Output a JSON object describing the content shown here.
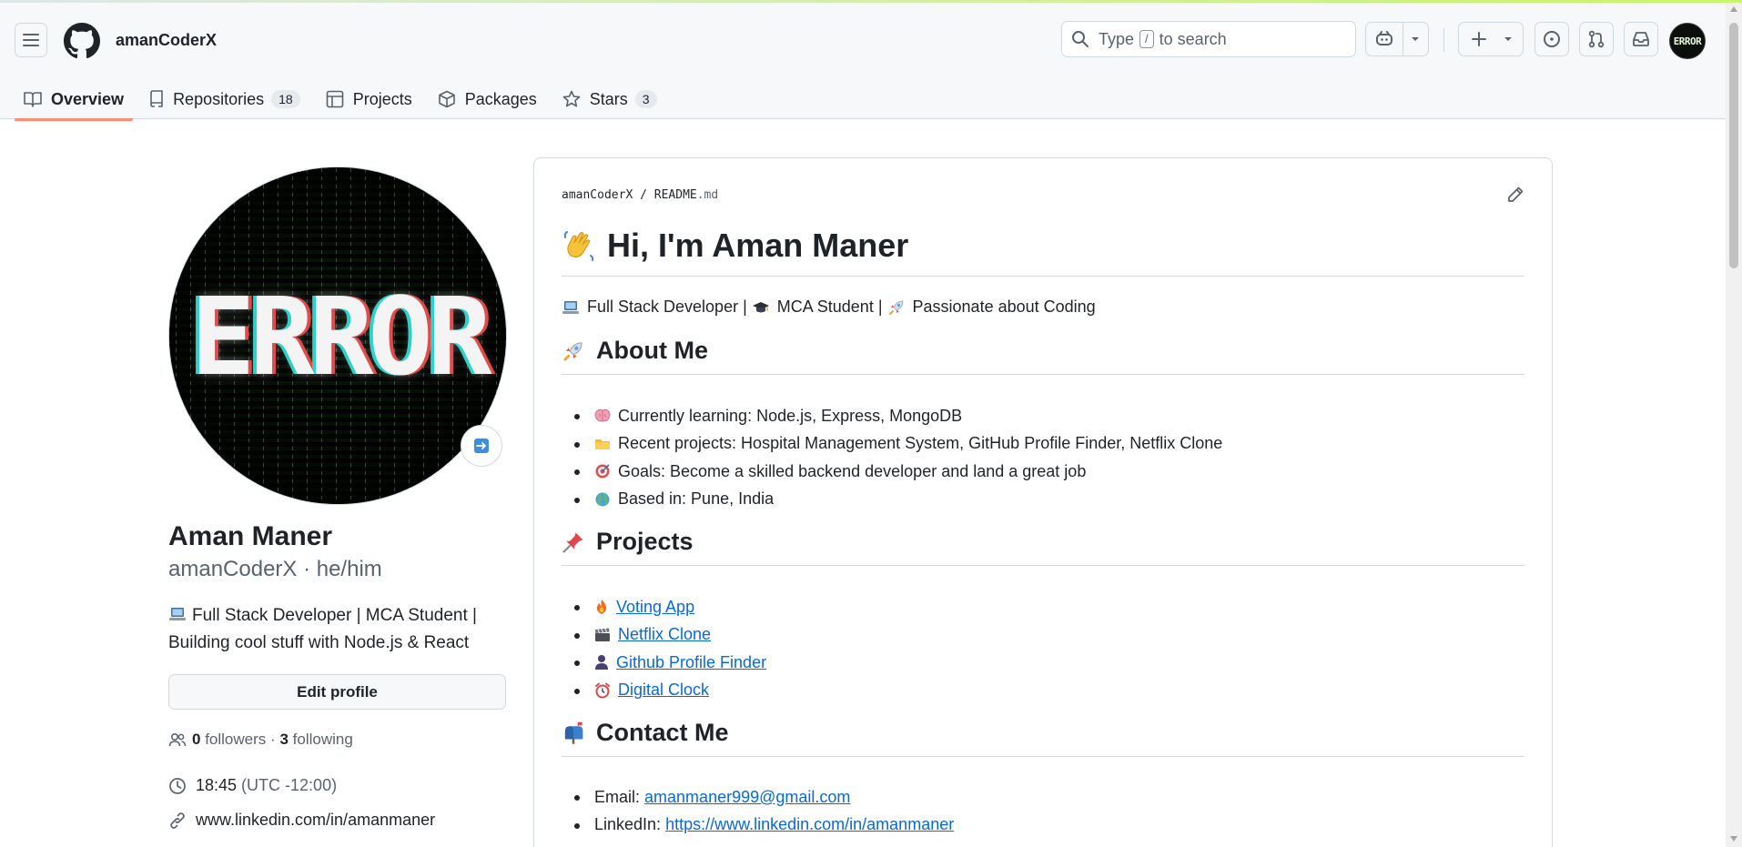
{
  "header": {
    "username": "amanCoderX",
    "search": {
      "prefix": "Type",
      "key": "/",
      "suffix": "to search"
    },
    "avatar_text": "ERROR"
  },
  "tabs": [
    {
      "label": "Overview",
      "icon": "book-icon",
      "active": true
    },
    {
      "label": "Repositories",
      "icon": "repo-icon",
      "count": "18"
    },
    {
      "label": "Projects",
      "icon": "table-icon"
    },
    {
      "label": "Packages",
      "icon": "package-icon"
    },
    {
      "label": "Stars",
      "icon": "star-icon",
      "count": "3"
    }
  ],
  "profile": {
    "avatar_text": "ERROR",
    "name": "Aman Maner",
    "login": "amanCoderX · he/him",
    "bio": "Full Stack Developer | MCA Student | Building cool stuff with Node.js & React",
    "edit_label": "Edit profile",
    "followers_count": "0",
    "followers_label": "followers",
    "separator": "·",
    "following_count": "3",
    "following_label": "following",
    "time": "18:45",
    "timezone": "(UTC -12:00)",
    "website": "www.linkedin.com/in/amanmaner"
  },
  "readme": {
    "path_owner": "amanCoderX",
    "path_sep": "/",
    "path_file": "README",
    "path_ext": ".md",
    "title": "Hi, I'm Aman Maner",
    "tagline_parts": [
      "Full Stack Developer |",
      "MCA Student |",
      "Passionate about Coding"
    ],
    "about_heading": "About Me",
    "about_items": [
      {
        "emoji": "brain-icon",
        "text": "Currently learning: Node.js, Express, MongoDB"
      },
      {
        "emoji": "folder-icon",
        "text": "Recent projects: Hospital Management System, GitHub Profile Finder, Netflix Clone"
      },
      {
        "emoji": "target-icon",
        "text": "Goals: Become a skilled backend developer and land a great job"
      },
      {
        "emoji": "globe-icon",
        "text": "Based in: Pune, India"
      }
    ],
    "projects_heading": "Projects",
    "projects": [
      {
        "emoji": "fire-icon",
        "text": "Voting App"
      },
      {
        "emoji": "clapper-icon",
        "text": "Netflix Clone"
      },
      {
        "emoji": "person-icon",
        "text": "Github Profile Finder"
      },
      {
        "emoji": "alarm-clock-icon",
        "text": "Digital Clock"
      }
    ],
    "contact_heading": "Contact Me",
    "contact": [
      {
        "label": "Email:",
        "value": "amanmaner999@gmail.com"
      },
      {
        "label": "LinkedIn:",
        "value": "https://www.linkedin.com/in/amanmaner"
      }
    ]
  },
  "colors": {
    "accent": "#fd8c73",
    "link": "#0969da",
    "border": "#d1d9e0",
    "muted": "#59636e"
  }
}
